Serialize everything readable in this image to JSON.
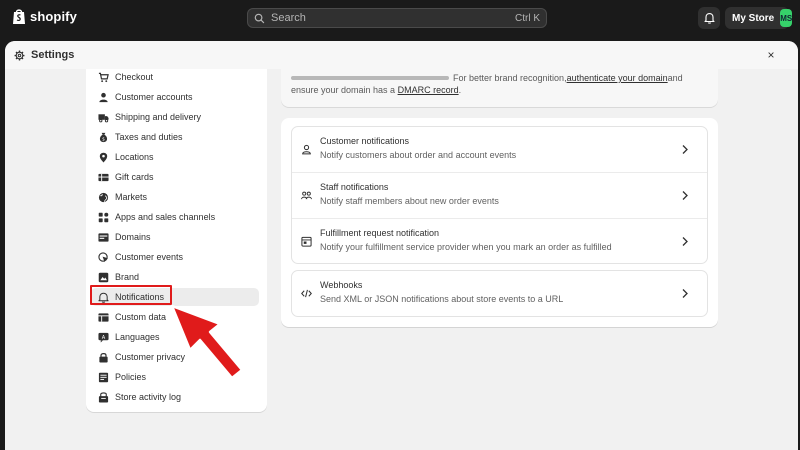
{
  "topbar": {
    "logo_text": "shopify",
    "search_placeholder": "Search",
    "search_shortcut": "Ctrl K",
    "store_name": "My Store",
    "avatar_initials": "MS"
  },
  "modal": {
    "title": "Settings",
    "close_label": "×"
  },
  "sidebar": {
    "items": [
      {
        "label": "Checkout",
        "icon": "cart-icon"
      },
      {
        "label": "Customer accounts",
        "icon": "person-icon"
      },
      {
        "label": "Shipping and delivery",
        "icon": "truck-icon"
      },
      {
        "label": "Taxes and duties",
        "icon": "money-bag-icon"
      },
      {
        "label": "Locations",
        "icon": "location-pin-icon"
      },
      {
        "label": "Gift cards",
        "icon": "gift-card-icon"
      },
      {
        "label": "Markets",
        "icon": "globe-icon"
      },
      {
        "label": "Apps and sales channels",
        "icon": "apps-icon"
      },
      {
        "label": "Domains",
        "icon": "domain-icon"
      },
      {
        "label": "Customer events",
        "icon": "cursor-icon"
      },
      {
        "label": "Brand",
        "icon": "brand-icon"
      },
      {
        "label": "Notifications",
        "icon": "bell-icon"
      },
      {
        "label": "Custom data",
        "icon": "database-icon"
      },
      {
        "label": "Languages",
        "icon": "language-icon"
      },
      {
        "label": "Customer privacy",
        "icon": "lock-icon"
      },
      {
        "label": "Policies",
        "icon": "policies-icon"
      },
      {
        "label": "Store activity log",
        "icon": "activity-log-icon"
      }
    ],
    "active_index": 11
  },
  "dmarc": {
    "text_before_link": "For better brand recognition, ",
    "link1": "authenticate your domain",
    "text_after_link1": " and",
    "line2_before": "ensure your domain has a ",
    "link2": "DMARC record",
    "line2_after": "."
  },
  "notifications": {
    "rows": [
      {
        "title": "Customer notifications",
        "desc": "Notify customers about order and account events",
        "icon": "customer-icon"
      },
      {
        "title": "Staff notifications",
        "desc": "Notify staff members about new order events",
        "icon": "staff-icon"
      },
      {
        "title": "Fulfillment request notification",
        "desc": "Notify your fulfillment service provider when you mark an order as fulfilled",
        "icon": "fulfillment-icon"
      }
    ],
    "webhook": {
      "title": "Webhooks",
      "desc": "Send XML or JSON notifications about store events to a URL",
      "icon": "code-icon"
    }
  },
  "colors": {
    "highlight": "#e01b1b",
    "avatar": "#36d16a",
    "topbar": "#1a1a1a"
  }
}
